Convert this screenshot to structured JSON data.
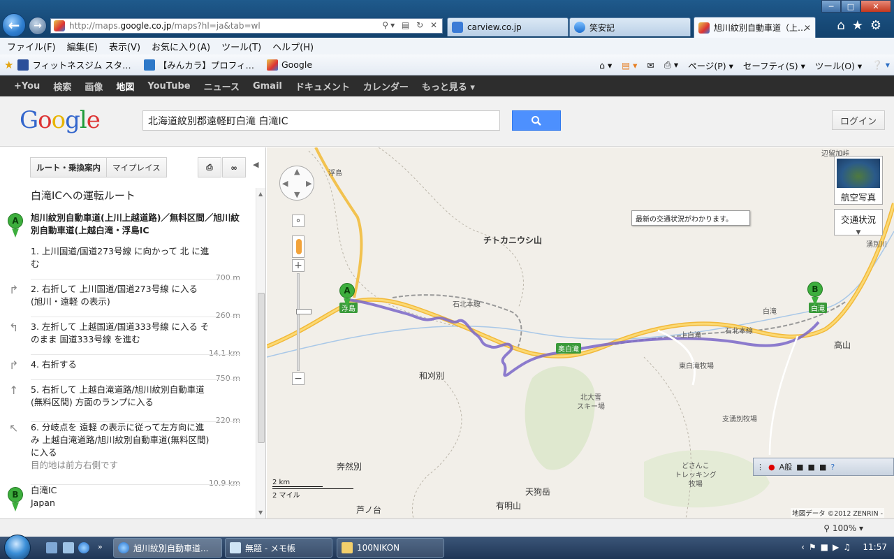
{
  "browser": {
    "address": {
      "prefix": "http://maps.",
      "domain": "google.co.jp",
      "suffix": "/maps?hl=ja&tab=wl"
    },
    "tabs": [
      {
        "label": "carview.co.jp"
      },
      {
        "label": "笑安記"
      },
      {
        "label": "旭川紋別自動車道（上…"
      }
    ],
    "menu": [
      "ファイル(F)",
      "編集(E)",
      "表示(V)",
      "お気に入り(A)",
      "ツール(T)",
      "ヘルプ(H)"
    ],
    "favorites": [
      "フィットネスジム スタ…",
      "【みんカラ】プロフィ…",
      "Google"
    ],
    "commands": [
      "ページ(P)",
      "セーフティ(S)",
      "ツール(O)"
    ]
  },
  "gbar": [
    "+You",
    "検索",
    "画像",
    "地図",
    "YouTube",
    "ニュース",
    "Gmail",
    "ドキュメント",
    "カレンダー",
    "もっと見る"
  ],
  "header": {
    "logo": "Google",
    "search_value": "北海道紋別郡遠軽町白滝 白滝IC",
    "login": "ログイン"
  },
  "panel": {
    "route_button": "ルート・乗換案内",
    "myplace_button": "マイプレイス",
    "title": "白滝ICへの運転ルート",
    "origin": "旭川紋別自動車道(上川上越道路)／無料区間／旭川紋別自動車道(上越白滝・浮島IC",
    "steps": [
      {
        "text": "1. 上川国道/国道273号線 に向かって 北 に進む",
        "dist": "700 m",
        "note": ""
      },
      {
        "text": "2. 右折して 上川国道/国道273号線 に入る (旭川・遠軽 の表示)",
        "dist": "260 m",
        "note": ""
      },
      {
        "text": "3. 左折して 上越国道/国道333号線 に入る そのまま 国道333号線 を進む",
        "dist": "14.1 km",
        "note": ""
      },
      {
        "text": "4. 右折する",
        "dist": "750 m",
        "note": ""
      },
      {
        "text": "5. 右折して 上越白滝道路/旭川紋別自動車道(無料区間) 方面のランプに入る",
        "dist": "220 m",
        "note": ""
      },
      {
        "text": "6. 分岐点を 遠軽 の表示に従って左方向に進み 上越白滝道路/旭川紋別自動車道(無料区間) に入る",
        "dist": "10.9 km",
        "note": "目的地は前方右側です"
      }
    ],
    "destination": {
      "name": "白滝IC",
      "country": "Japan"
    },
    "marker_a": "A",
    "marker_b": "B"
  },
  "map": {
    "labels": {
      "ukishima_top": "浮島",
      "chitokaniushi": "チトカニウシ山",
      "sekihoku1": "石北本線",
      "sekihoku2": "石北本線",
      "wakaribetsu": "和刈別",
      "kitataisetsu": "北大雪\nスキー場",
      "higashishirataki": "東白滝牧場",
      "kamishirataki": "上白滝",
      "shirataki": "白滝",
      "takayama": "高山",
      "shiyubetsu": "支湧別牧場",
      "okenpetsu": "奔然別",
      "tengudake": "天狗岳",
      "aribetsu": "有明山",
      "ashinodai": "芦ノ台",
      "dosanko": "どさんこ\nトレッキング\n牧場",
      "yubetsugawa": "湧別川",
      "top_right": "辺留加峠",
      "ukishima_ic": "浮島",
      "shirataki_ic": "白滝",
      "okushirataki_ic": "奥白滝"
    },
    "satellite": "航空写真",
    "traffic": "交通状況",
    "traffic_tip": "最新の交通状況がわかります。",
    "scale_km": "2 km",
    "scale_mile": "2 マイル",
    "copyright": "地図データ ©2012 ZENRIN -"
  },
  "status": {
    "zoom": "100%"
  },
  "taskbar": {
    "items": [
      "旭川紋別自動車道...",
      "無題 - メモ帳",
      "100NIKON"
    ],
    "clock": "11:57"
  }
}
